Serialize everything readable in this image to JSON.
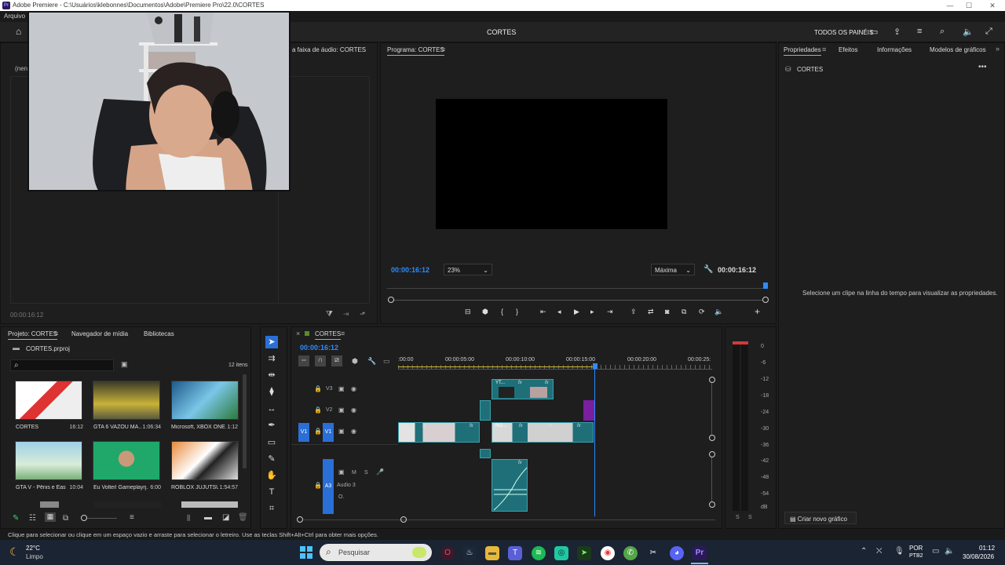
{
  "window": {
    "title": "Adobe Premiere - C:\\Usuários\\klebonnes\\Documentos\\Adobe\\Premiere Pro\\22.0\\CORTES",
    "menu_first": "Arquivo"
  },
  "header": {
    "center_title": "CORTES",
    "panels_label": "TODOS OS PAINÉIS"
  },
  "source_panel": {
    "tab_partial": "a faixa de áudio: CORTES",
    "left_label": "(nen",
    "timecode": "00:00:16:12"
  },
  "program_monitor": {
    "tab": "Programa: CORTES",
    "timecode_left": "00:00:16:12",
    "zoom": "23%",
    "quality": "Máxima",
    "timecode_right": "00:00:16:12"
  },
  "properties": {
    "tabs": [
      "Propriedades",
      "Efeitos",
      "Informações",
      "Modelos de gráficos"
    ],
    "item": "CORTES",
    "message": "Selecione um clipe na linha do tempo para visualizar as propriedades.",
    "create_graphic": "Criar novo gráfico"
  },
  "project": {
    "tabs": [
      "Projeto: CORTES",
      "Navegador de mídia",
      "Bibliotecas"
    ],
    "file": "CORTES.prproj",
    "count": "12 itens",
    "items": [
      {
        "name": "CORTES",
        "dur": "16:12"
      },
      {
        "name": "GTA 6 VAZOU MA...",
        "dur": "1:06:34"
      },
      {
        "name": "Microsoft, XBOX ONE...",
        "dur": "1:12"
      },
      {
        "name": "GTA V - Pênis e East...",
        "dur": "10:04"
      },
      {
        "name": "Eu Voltei! Gameplayrj...",
        "dur": "6:00"
      },
      {
        "name": "ROBLOX JUJUTSU ...",
        "dur": "1:54:57"
      }
    ]
  },
  "timeline": {
    "tab": "CORTES",
    "timecode": "00:00:16:12",
    "ruler": [
      ":00:00",
      "00:00:05:00",
      "00:00:10:00",
      "00:00:15:00",
      "00:00:20:00",
      "00:00:25:"
    ],
    "tracks": [
      "V3",
      "V2",
      "V1",
      "A3"
    ],
    "v1_source": "V1",
    "audio_name": "Audio 3",
    "audio_m": "M",
    "audio_s": "S",
    "clip_yt": "YT...",
    "clip_ro": "RO...",
    "fx": "fx",
    "audio_o": "O."
  },
  "meter": {
    "labels": [
      "0",
      "-6",
      "-12",
      "-18",
      "-24",
      "-30",
      "-36",
      "-42",
      "-48",
      "-54",
      "dB"
    ],
    "bottom": [
      "S",
      "S"
    ]
  },
  "status_bar": {
    "text": "Clique para selecionar ou clique em um espaço vazio e arraste para selecionar o letreiro. Use as teclas Shift+Alt+Ctrl para obter mais opções."
  },
  "taskbar": {
    "temp": "22°C",
    "weather": "Limpo",
    "search": "Pesquisar",
    "lang1": "POR",
    "lang2": "PTB2",
    "time": "01:12",
    "date": "30/08/2026"
  },
  "colors": {
    "accent_blue": "#2c8cff",
    "clip_teal": "#1f6f79",
    "clip_purple": "#7a1fa0",
    "meter_red": "#d33a3a"
  }
}
